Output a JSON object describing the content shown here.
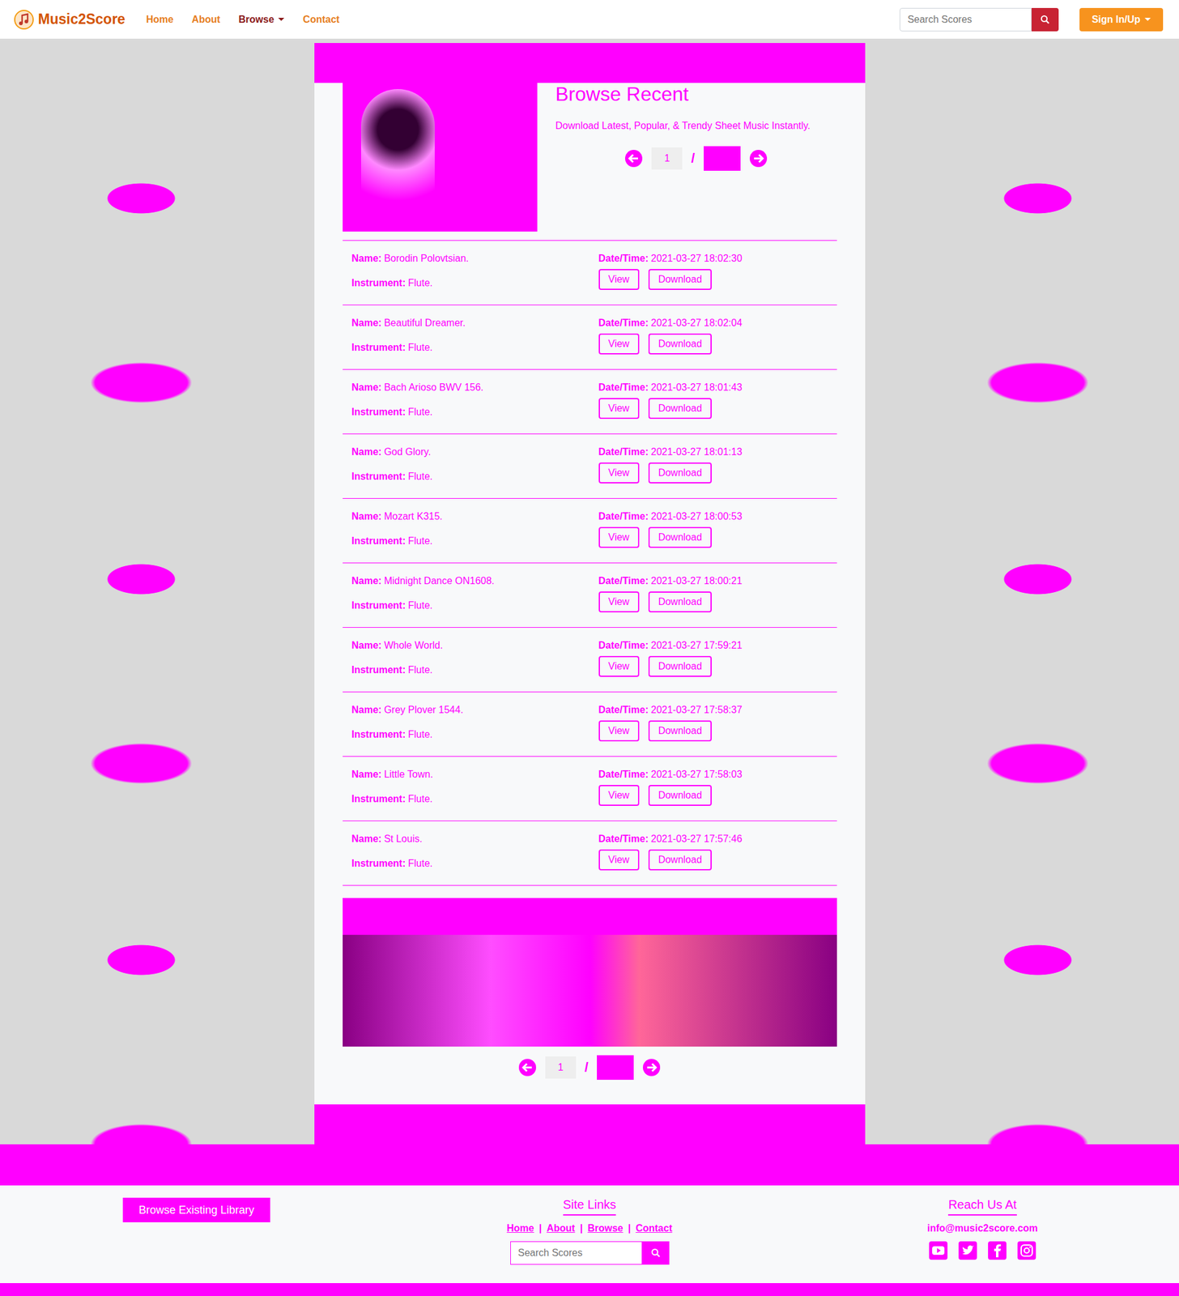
{
  "nav": {
    "brand": "Music2Score",
    "links": [
      {
        "label": "Home",
        "selected": false,
        "dropdown": false
      },
      {
        "label": "About",
        "selected": false,
        "dropdown": false
      },
      {
        "label": "Browse",
        "selected": true,
        "dropdown": true
      },
      {
        "label": "Contact",
        "selected": false,
        "dropdown": false
      }
    ],
    "search": {
      "placeholder": "Search Scores"
    },
    "account": {
      "label": "Sign In/Up"
    }
  },
  "hero": {
    "title": "Browse Recent",
    "subtitle": "Download Latest, Popular, & Trendy Sheet Music Instantly.",
    "pager": {
      "current": "1",
      "separator": "/"
    }
  },
  "labels": {
    "name": "Name:",
    "instrument": "Instrument:",
    "datetime": "Date/Time:",
    "view": "View",
    "download": "Download"
  },
  "scores": [
    {
      "name": "Borodin Polovtsian.",
      "instrument": "Flute.",
      "datetime": "2021-03-27 18:02:30"
    },
    {
      "name": "Beautiful Dreamer.",
      "instrument": "Flute.",
      "datetime": "2021-03-27 18:02:04"
    },
    {
      "name": "Bach Arioso BWV 156.",
      "instrument": "Flute.",
      "datetime": "2021-03-27 18:01:43"
    },
    {
      "name": "God Glory.",
      "instrument": "Flute.",
      "datetime": "2021-03-27 18:01:13"
    },
    {
      "name": "Mozart K315.",
      "instrument": "Flute.",
      "datetime": "2021-03-27 18:00:53"
    },
    {
      "name": "Midnight Dance ON1608.",
      "instrument": "Flute.",
      "datetime": "2021-03-27 18:00:21"
    },
    {
      "name": "Whole World.",
      "instrument": "Flute.",
      "datetime": "2021-03-27 17:59:21"
    },
    {
      "name": "Grey Plover 1544.",
      "instrument": "Flute.",
      "datetime": "2021-03-27 17:58:37"
    },
    {
      "name": "Little Town.",
      "instrument": "Flute.",
      "datetime": "2021-03-27 17:58:03"
    },
    {
      "name": "St Louis.",
      "instrument": "Flute.",
      "datetime": "2021-03-27 17:57:46"
    }
  ],
  "bottom_pager": {
    "current": "1",
    "separator": "/"
  },
  "footer": {
    "left": {
      "buttons": [
        "Browse Existing Library"
      ]
    },
    "site_links": {
      "title": "Site Links",
      "links": [
        "Home",
        "About",
        "Browse",
        "Contact"
      ],
      "separator": "|",
      "search": {
        "placeholder": "Search Scores"
      }
    },
    "contact": {
      "title": "Reach Us At",
      "email": "info@music2score.com"
    }
  }
}
